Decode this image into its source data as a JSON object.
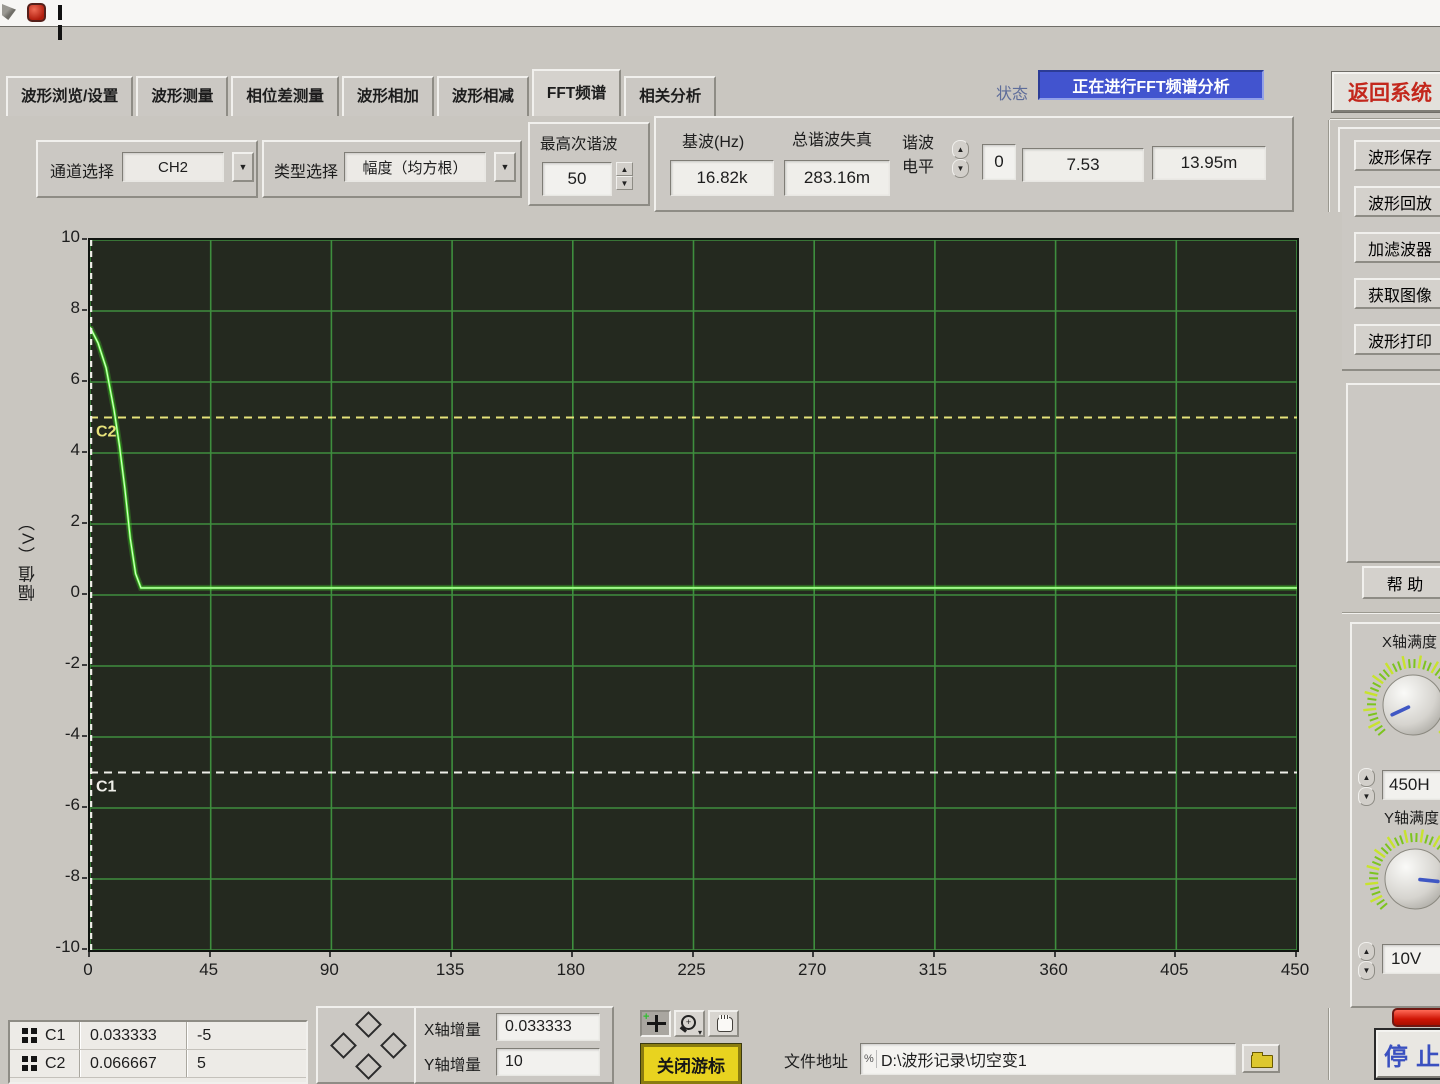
{
  "icons": {
    "dropdown_arrow": "▼",
    "spin_up": "▲",
    "spin_down": "▼",
    "path_glyph": "%"
  },
  "tabs": [
    {
      "label": "波形浏览/设置",
      "active": false
    },
    {
      "label": "波形测量",
      "active": false
    },
    {
      "label": "相位差测量",
      "active": false
    },
    {
      "label": "波形相加",
      "active": false
    },
    {
      "label": "波形相减",
      "active": false
    },
    {
      "label": "FFT频谱",
      "active": true
    },
    {
      "label": "相关分析",
      "active": false
    }
  ],
  "status": {
    "label": "状态",
    "value": "正在进行FFT频谱分析"
  },
  "return_system_button": "返回系统",
  "controls": {
    "channel_label": "通道选择",
    "channel_value": "CH2",
    "type_label": "类型选择",
    "type_value": "幅度（均方根）",
    "max_harmonic_label": "最高次谐波",
    "max_harmonic_value": "50",
    "fundamental_label": "基波(Hz)",
    "fundamental_value": "16.82k",
    "thd_label": "总谐波失真",
    "thd_value": "283.16m",
    "harmonic_level_label": "谐波电平",
    "harmonic_index": "0",
    "harmonic_value": "7.53",
    "harmonic_value2": "13.95m"
  },
  "side_buttons": [
    {
      "label": "波形保存"
    },
    {
      "label": "波形回放"
    },
    {
      "label": "加滤波器"
    },
    {
      "label": "获取图像"
    },
    {
      "label": "波形打印"
    }
  ],
  "help_button": "帮 助",
  "scale_panel": {
    "x_label": "X轴满度",
    "x_value": "450H",
    "y_label": "Y轴满度",
    "y_value": "10V"
  },
  "stop_button": "停止",
  "chart_data": {
    "type": "line",
    "title": "",
    "xlabel": "",
    "ylabel": "幅值（V）",
    "xlim": [
      0,
      450
    ],
    "ylim": [
      -10,
      10
    ],
    "x_ticks": [
      0,
      45,
      90,
      135,
      180,
      225,
      270,
      315,
      360,
      405,
      450
    ],
    "y_ticks": [
      10,
      8,
      6,
      4,
      2,
      0,
      -2,
      -4,
      -6,
      -8,
      -10
    ],
    "grid": true,
    "plot_bg": "#24291f",
    "grid_color": "#3e8e3e",
    "series": [
      {
        "name": "CH2",
        "color": "#49e02c",
        "points": [
          [
            0,
            7.55
          ],
          [
            3,
            7.1
          ],
          [
            6,
            6.4
          ],
          [
            9,
            5.2
          ],
          [
            11,
            4.2
          ],
          [
            13,
            3.0
          ],
          [
            15,
            1.6
          ],
          [
            17,
            0.6
          ],
          [
            19,
            0.2
          ],
          [
            450,
            0.2
          ]
        ]
      }
    ],
    "cursors": [
      {
        "name": "C1",
        "x": 0.033333,
        "y": -5,
        "color": "#eeeee8"
      },
      {
        "name": "C2",
        "x": 0.066667,
        "y": 5,
        "color": "#e6e27a"
      }
    ]
  },
  "cursor_legend": {
    "rows": [
      {
        "name": "C1",
        "x": "0.033333",
        "y": "-5"
      },
      {
        "name": "C2",
        "x": "0.066667",
        "y": "5"
      }
    ]
  },
  "increments": {
    "x_label": "X轴增量",
    "x_value": "0.033333",
    "y_label": "Y轴增量",
    "y_value": "10"
  },
  "close_cursor_button": "关闭游标",
  "file_bar": {
    "label": "文件地址",
    "path": "D:\\波形记录\\切空变1"
  },
  "colors": {
    "status_bg": "#4254cf",
    "accent_red": "#c3271c",
    "trace_green": "#49e02c",
    "cursor_c1": "#eeeee8",
    "cursor_c2": "#e6e27a",
    "close_cursor_bg": "#e8d31f",
    "stop_text_blue": "#3a50c0"
  }
}
